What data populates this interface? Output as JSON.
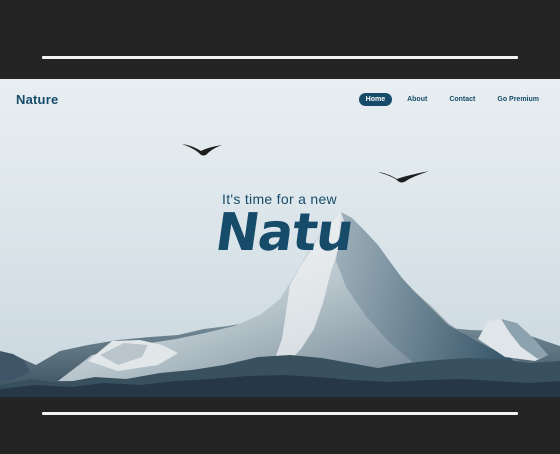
{
  "brand": {
    "name": "Nature"
  },
  "nav": {
    "items": [
      {
        "label": "Home",
        "active": true
      },
      {
        "label": "About",
        "active": false
      },
      {
        "label": "Contact",
        "active": false
      },
      {
        "label": "Go Premium",
        "active": false
      }
    ]
  },
  "hero": {
    "subtitle": "It's time for a new",
    "title": "Natu"
  },
  "colors": {
    "frame_background": "#242424",
    "accent": "#174b6a",
    "sky": "#dfe8ec"
  },
  "icons": [
    "bird-icon",
    "bird-icon"
  ]
}
